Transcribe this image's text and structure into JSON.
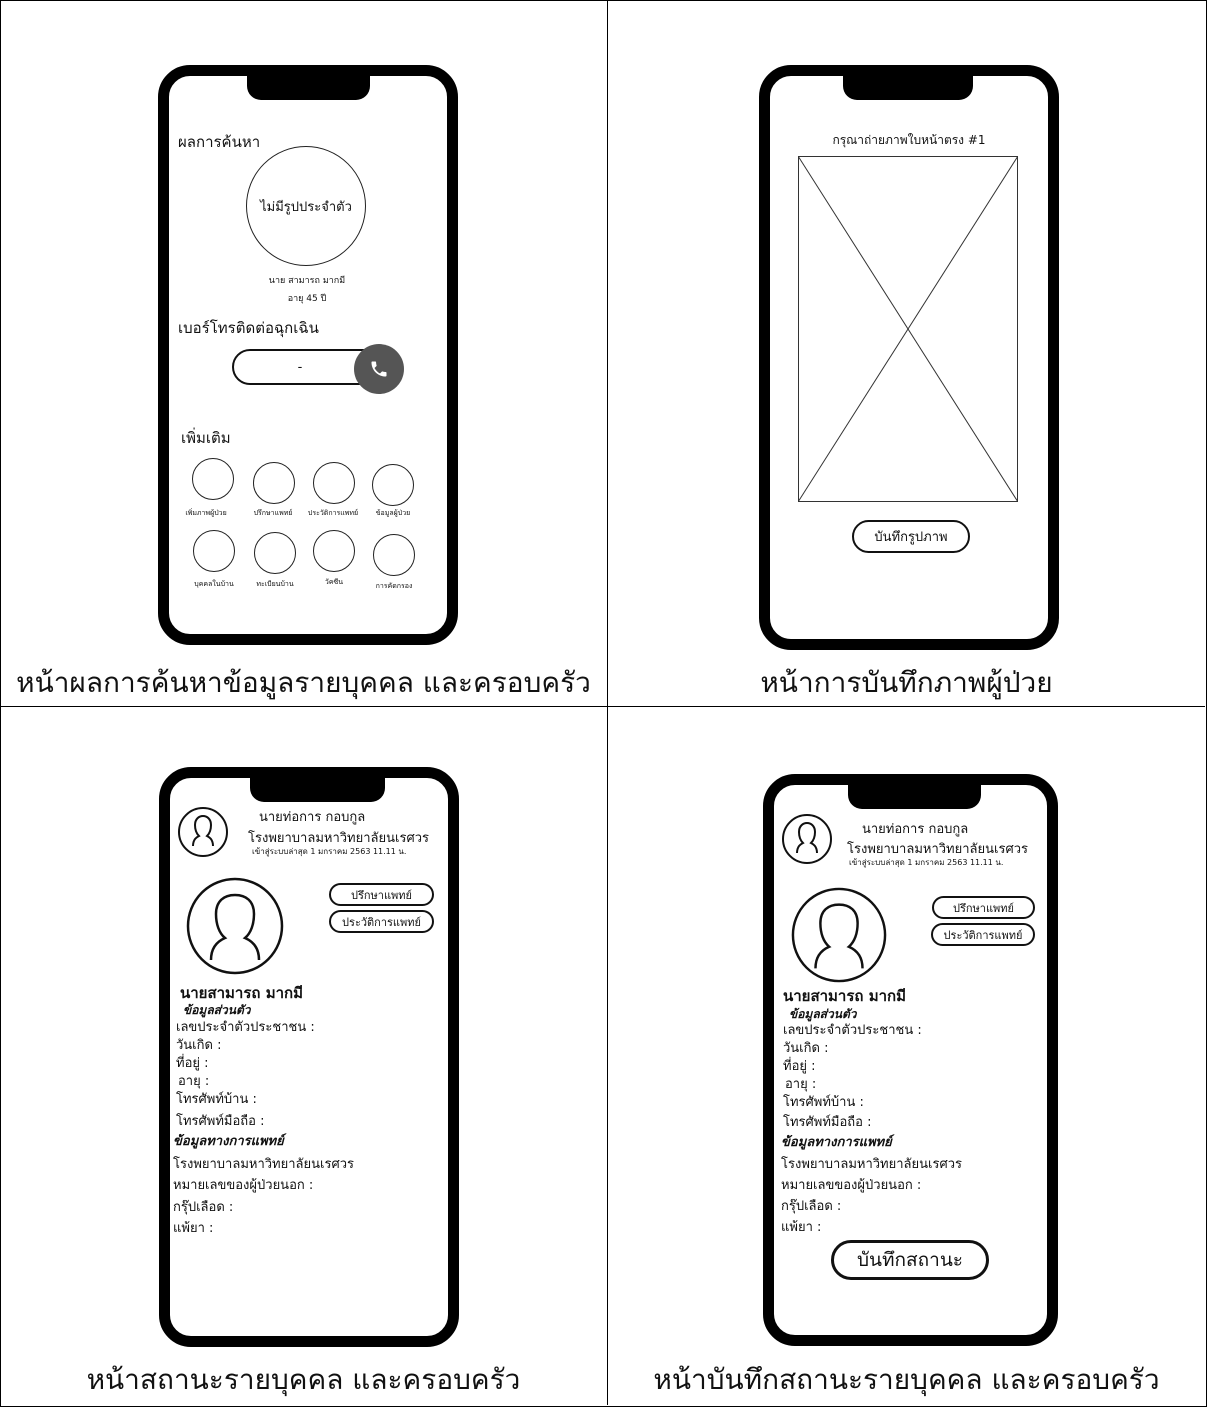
{
  "captions": {
    "q1": "หน้าผลการค้นหาข้อมูลรายบุคคล และครอบครัว",
    "q2": "หน้าการบันทึกภาพผู้ป่วย",
    "q3": "หน้าสถานะรายบุคคล และครอบครัว",
    "q4": "หน้าบันทึกสถานะรายบุคคล และครอบครัว"
  },
  "search": {
    "title": "ผลการค้นหา",
    "no_photo": "ไม่มีรูปประจำตัว",
    "name": "นาย สามารถ มากมี",
    "age": "อายุ 45 ปี",
    "emergency_title": "เบอร์โทรติดต่อฉุกเฉิน",
    "phone_value": "-",
    "more_title": "เพิ่มเติม",
    "menu": [
      "เพิ่มภาพผู้ป่วย",
      "ปรึกษาแพทย์",
      "ประวัติการแพทย์",
      "ข้อมูลผู้ป่วย",
      "บุคคลในบ้าน",
      "ทะเบียนบ้าน",
      "วัคซีน",
      "การคัดกรอง"
    ]
  },
  "photo": {
    "title": "กรุณาถ่ายภาพใบหน้าตรง #1",
    "save": "บันทึกรูปภาพ"
  },
  "status": {
    "user_name": "นายท่อการ กอบกูล",
    "hospital": "โรงพยาบาลมหาวิทยาลัยนเรศวร",
    "last_login": "เข้าสู่ระบบล่าสุด 1 มกราคม 2563 11.11 น.",
    "consult_btn": "ปรึกษาแพทย์",
    "history_btn": "ประวัติการแพทย์",
    "patient_name": "นายสามารถ มากมี",
    "personal_title": "ข้อมูลส่วนตัว",
    "personal_fields": [
      "เลขประจำตัวประชาชน :",
      "วันเกิด :",
      "ที่อยู่ :",
      "อายุ :",
      "โทรศัพท์บ้าน :",
      "โทรศัพท์มือถือ :"
    ],
    "medical_title": "ข้อมูลทางการแพทย์",
    "medical_fields": [
      "โรงพยาบาลมหาวิทยาลัยนเรศวร",
      "หมายเลขของผู้ป่วยนอก :",
      "กรุ๊ปเลือด :",
      "แพ้ยา :"
    ],
    "save_status": "บันทึกสถานะ"
  }
}
